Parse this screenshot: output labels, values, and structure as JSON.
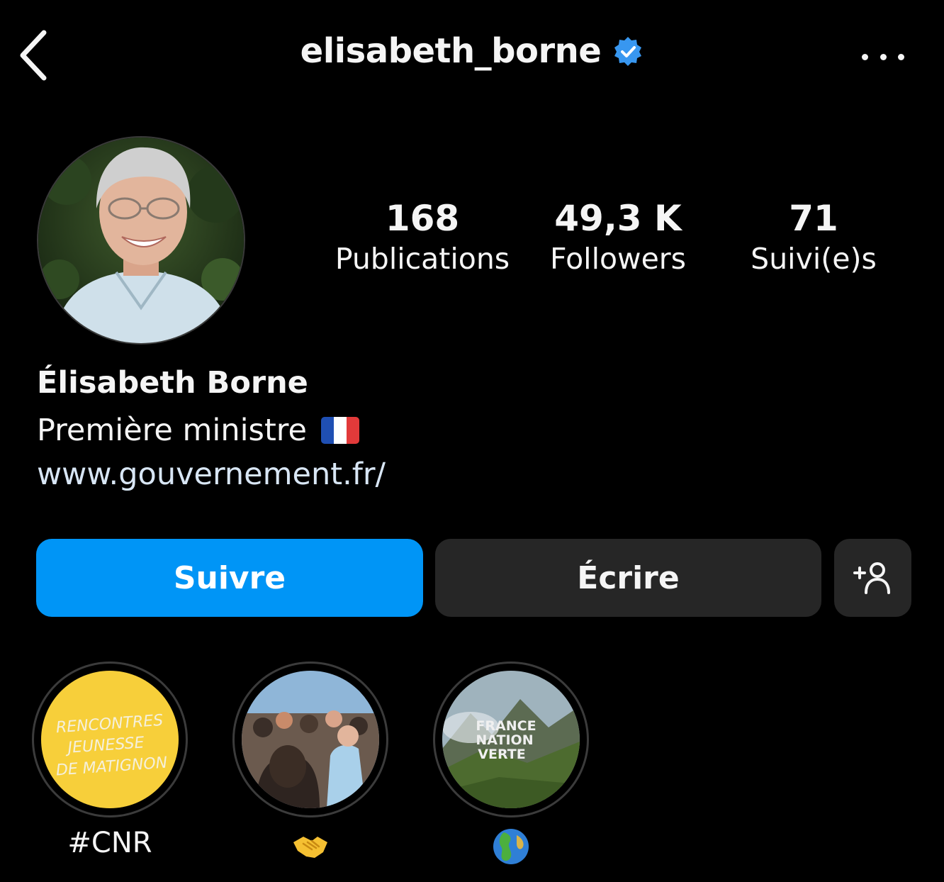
{
  "header": {
    "username": "elisabeth_borne",
    "back_icon": "chevron-left-icon",
    "verified_icon": "verified-badge-icon",
    "more_icon": "more-horizontal-icon"
  },
  "profile": {
    "avatar": "profile-photo",
    "stats": [
      {
        "value": "168",
        "label": "Publications"
      },
      {
        "value": "49,3 K",
        "label": "Followers"
      },
      {
        "value": "71",
        "label": "Suivi(e)s"
      }
    ],
    "full_name": "Élisabeth Borne",
    "bio": "Première ministre",
    "bio_flag_icon": "flag-france-icon",
    "link": "www.gouvernement.fr/"
  },
  "actions": {
    "follow_label": "Suivre",
    "message_label": "Écrire",
    "add_user_icon": "add-person-icon"
  },
  "highlights": [
    {
      "label": "#CNR",
      "cover_text": [
        "RENCONTRES",
        "JEUNESSE",
        "DE MATIGNON"
      ]
    },
    {
      "label": "",
      "label_icon": "handshake-emoji-icon"
    },
    {
      "label": "",
      "label_icon": "globe-emoji-icon",
      "cover_text": [
        "FRANCE",
        "NATION",
        "VERTE"
      ]
    }
  ],
  "colors": {
    "background": "#000000",
    "primary_button": "#0095f6",
    "secondary_button": "#262626",
    "verified": "#3897f0",
    "link": "#d8e6f5",
    "highlight_yellow": "#f7cf3a"
  }
}
